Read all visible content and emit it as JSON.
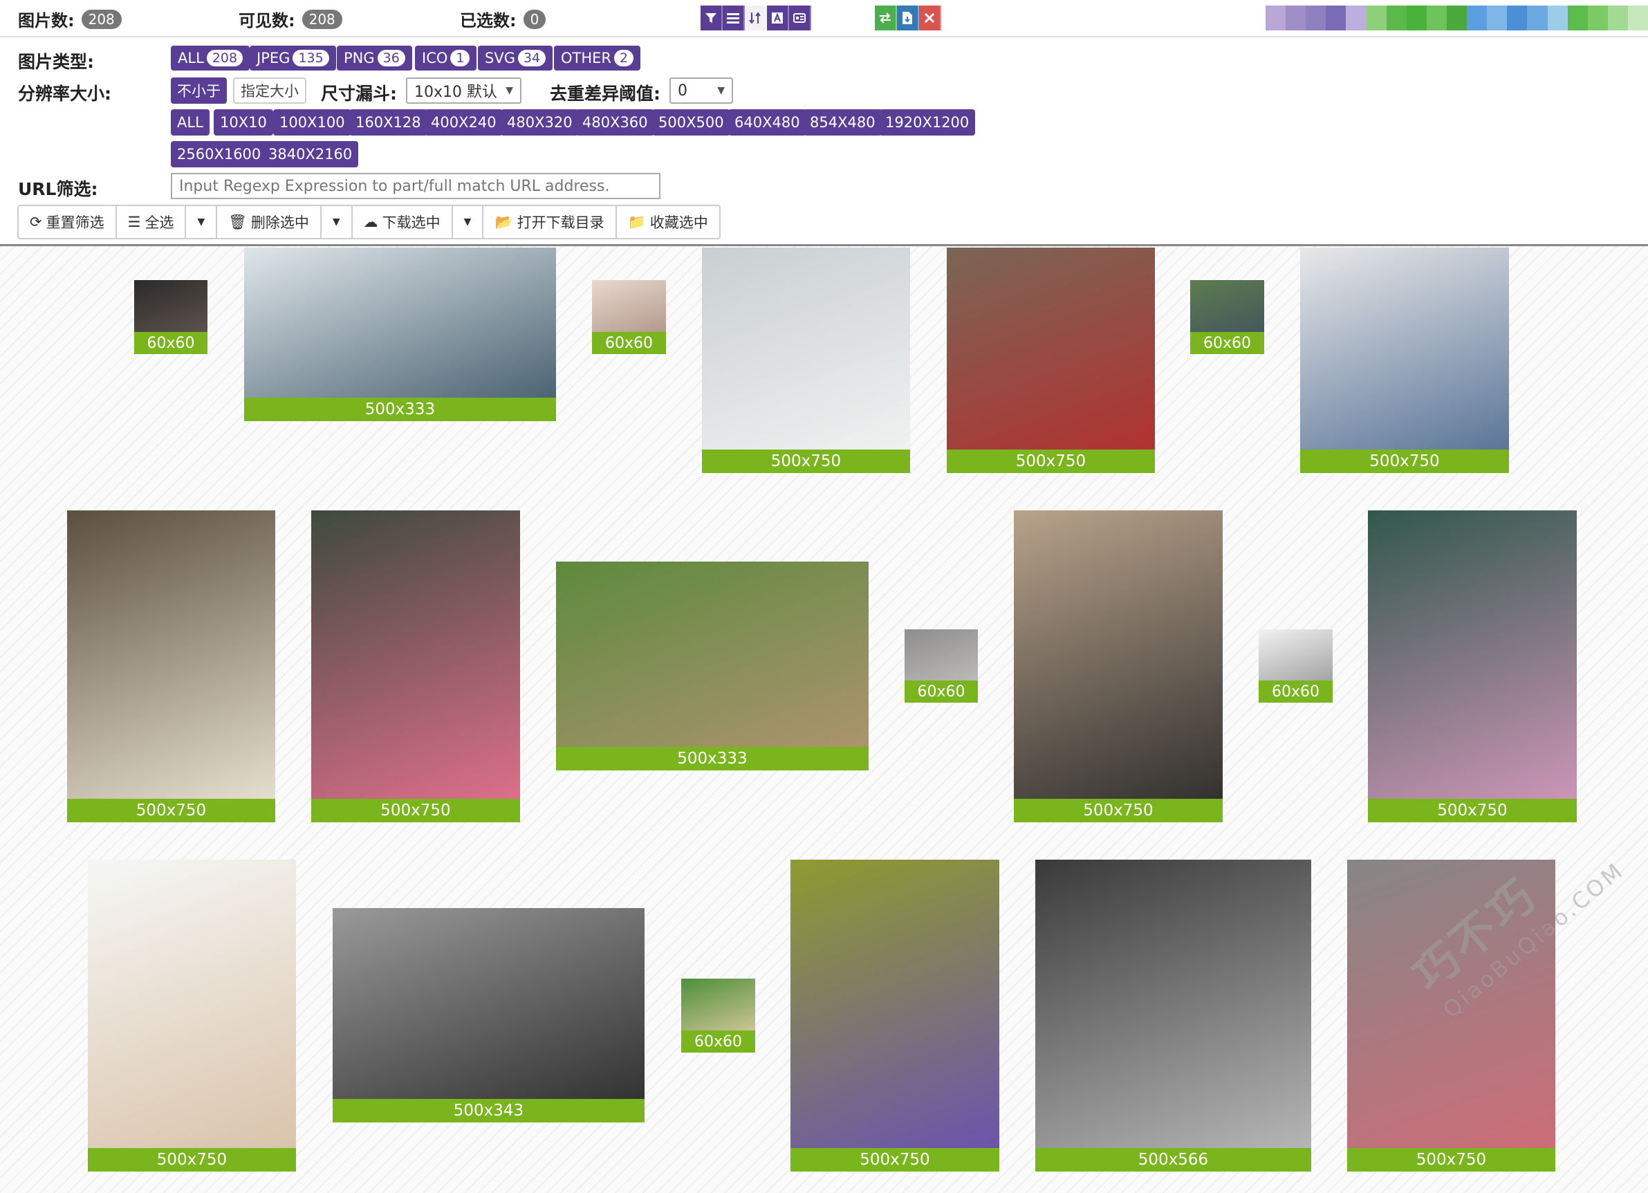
{
  "stats": {
    "total_label": "图片数:",
    "total": "208",
    "visible_label": "可见数:",
    "visible": "208",
    "selected_label": "已选数:",
    "selected": "0"
  },
  "toolbar_icons": [
    "filter-icon",
    "list-icon",
    "sort-icon",
    "text-a-icon",
    "settings-icon"
  ],
  "toolbar_right_icons": [
    "swap-icon",
    "export-icon",
    "close-icon"
  ],
  "filters": {
    "type_label": "图片类型:",
    "types": [
      {
        "label": "ALL",
        "count": "208"
      },
      {
        "label": "JPEG",
        "count": "135"
      },
      {
        "label": "PNG",
        "count": "36"
      },
      {
        "label": "ICO",
        "count": "1"
      },
      {
        "label": "SVG",
        "count": "34"
      },
      {
        "label": "OTHER",
        "count": "2"
      }
    ],
    "resolution_label": "分辨率大小:",
    "mode_selected": "不小于",
    "mode_other": "指定大小",
    "funnel_label": "尺寸漏斗:",
    "funnel_value": "10x10 默认",
    "dedupe_label": "去重差异阈值:",
    "dedupe_value": "0",
    "resolutions": [
      "ALL",
      "10X10",
      "100X100",
      "160X128",
      "400X240",
      "480X320",
      "480X360",
      "500X500",
      "640X480",
      "854X480",
      "1920X1200",
      "2560X1600",
      "3840X2160"
    ],
    "url_label": "URL筛选:",
    "url_placeholder": "Input Regexp Expression to part/full match URL address."
  },
  "actions": {
    "reset": "重置筛选",
    "select_all": "全选",
    "delete": "删除选中",
    "download": "下载选中",
    "open_dir": "打开下载目录",
    "favorite": "收藏选中"
  },
  "images": [
    {
      "size": "60x60",
      "colors": [
        "#2b2b2b",
        "#6b5d55"
      ]
    },
    {
      "size": "500x333",
      "colors": [
        "#dfe6ea",
        "#3f5868"
      ]
    },
    {
      "size": "60x60",
      "colors": [
        "#e9d9cf",
        "#a5877a"
      ]
    },
    {
      "size": "500x750",
      "colors": [
        "#c9cfd1",
        "#f3f3f3"
      ]
    },
    {
      "size": "500x750",
      "colors": [
        "#7a6656",
        "#b62d2d"
      ]
    },
    {
      "size": "60x60",
      "colors": [
        "#5c7d4d",
        "#3e4d63"
      ]
    },
    {
      "size": "500x750",
      "colors": [
        "#e8e8e8",
        "#4f6c92"
      ]
    },
    {
      "size": "500x750",
      "colors": [
        "#5b4f3e",
        "#efe8d6"
      ]
    },
    {
      "size": "500x750",
      "colors": [
        "#3f4a3c",
        "#e7718f"
      ]
    },
    {
      "size": "500x333",
      "colors": [
        "#5d8a3e",
        "#b29472"
      ]
    },
    {
      "size": "60x60",
      "colors": [
        "#8e8c8c",
        "#c9c7c5"
      ]
    },
    {
      "size": "500x750",
      "colors": [
        "#b8a28a",
        "#2a2a2a"
      ]
    },
    {
      "size": "60x60",
      "colors": [
        "#f2f2f2",
        "#8d8d8d"
      ]
    },
    {
      "size": "500x750",
      "colors": [
        "#31584c",
        "#d699bd"
      ]
    },
    {
      "size": "500x750",
      "colors": [
        "#f5f7f5",
        "#d8c0a6"
      ]
    },
    {
      "size": "500x343",
      "colors": [
        "#999999",
        "#2b2b2b"
      ]
    },
    {
      "size": "60x60",
      "colors": [
        "#4e8f3a",
        "#f0d2ad"
      ]
    },
    {
      "size": "500x750",
      "colors": [
        "#8e9b2e",
        "#6a4fb6"
      ]
    },
    {
      "size": "500x566",
      "colors": [
        "#3a3a3a",
        "#bdbdbd"
      ]
    },
    {
      "size": "500x750",
      "colors": [
        "#868686",
        "#d16b77"
      ]
    }
  ],
  "watermark": {
    "main": "巧不巧",
    "url": "QiaoBuQiao.COM"
  },
  "colors": {
    "accent": "#5a3d95",
    "caption": "#7ab51d"
  }
}
